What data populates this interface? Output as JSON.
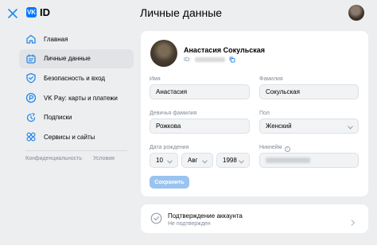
{
  "header": {
    "logo_text": "ID",
    "logo_badge": "VK",
    "title": "Личные данные"
  },
  "sidebar": {
    "items": [
      {
        "label": "Главная",
        "icon": "home-icon"
      },
      {
        "label": "Личные данные",
        "icon": "id-card-icon",
        "active": true
      },
      {
        "label": "Безопасность и вход",
        "icon": "shield-icon"
      },
      {
        "label": "VK Pay: карты и платежи",
        "icon": "pay-icon"
      },
      {
        "label": "Подписки",
        "icon": "subscription-icon"
      },
      {
        "label": "Сервисы и сайты",
        "icon": "services-icon"
      }
    ],
    "footer": {
      "privacy": "Конфиденциальность",
      "terms": "Условия"
    }
  },
  "profile": {
    "name": "Анастасия Сокульская",
    "id_prefix": "ID:"
  },
  "form": {
    "first_name": {
      "label": "Имя",
      "value": "Анастасия"
    },
    "last_name": {
      "label": "Фамилия",
      "value": "Сокульская"
    },
    "maiden_name": {
      "label": "Девичья фамилия",
      "value": "Рожкова"
    },
    "gender": {
      "label": "Пол",
      "value": "Женский"
    },
    "birthdate": {
      "label": "Дата рождения",
      "day": "10",
      "month": "Авг",
      "year": "1998"
    },
    "nickname": {
      "label": "Никнейм"
    },
    "save_label": "Сохранить"
  },
  "verification": {
    "title": "Подтверждение аккаунта",
    "status": "Не подтвержден"
  },
  "colors": {
    "accent": "#2688eb",
    "background": "#edeef0",
    "active_item": "#e1e3e6",
    "button_disabled": "#9ac3f0"
  }
}
